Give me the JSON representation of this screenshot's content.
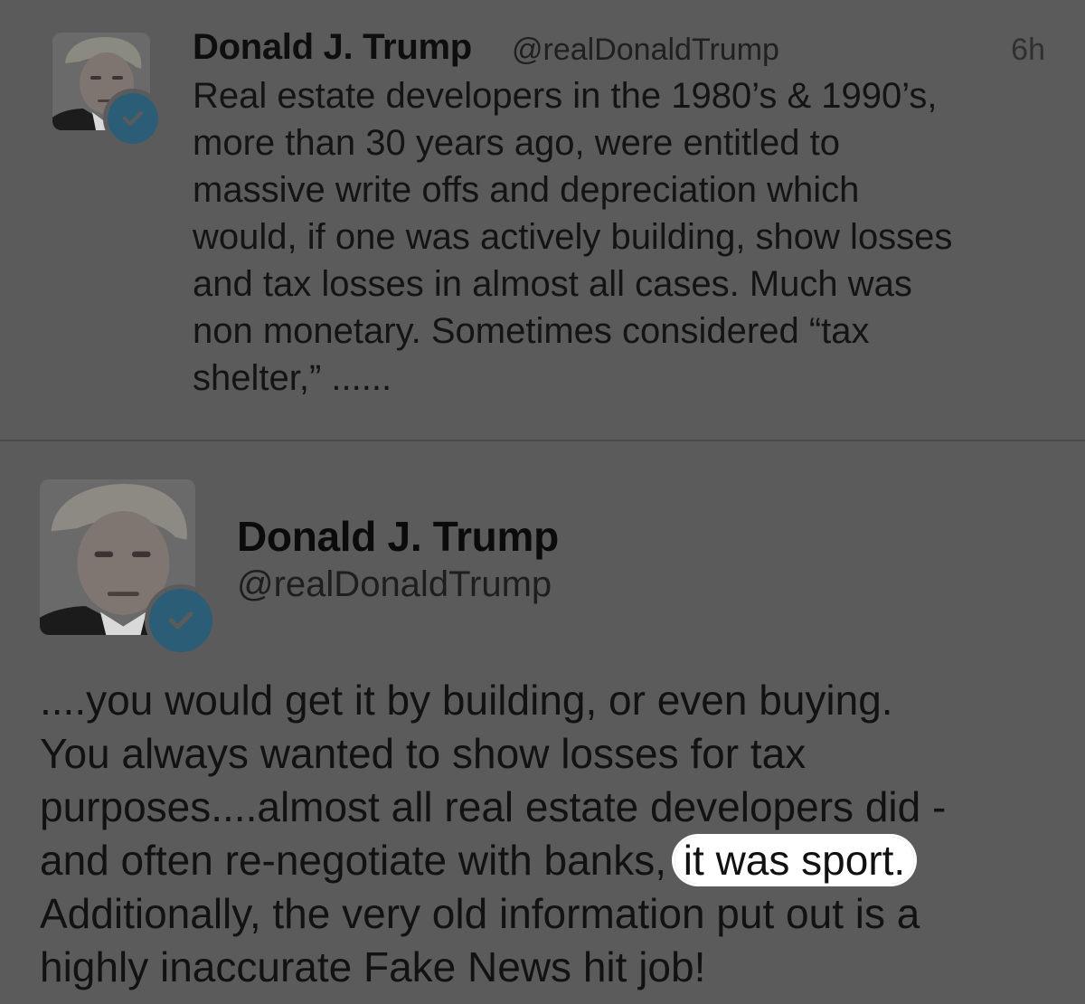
{
  "tweet1": {
    "author_name": "Donald J. Trump",
    "handle": "@realDonaldTrump",
    "timestamp": "6h",
    "avatar_icon": "profile-photo",
    "verified_icon": "verified-badge-icon",
    "lines": [
      "Real estate developers in the 1980’s & 1990’s,",
      "more than 30 years ago, were entitled to",
      "massive write offs and depreciation which",
      "would, if one was actively building, show losses",
      "and tax losses in almost all cases. Much was",
      "non monetary. Sometimes considered “tax",
      "shelter,” ......"
    ]
  },
  "tweet2": {
    "author_name": "Donald J. Trump",
    "handle": "@realDonaldTrump",
    "avatar_icon": "profile-photo",
    "verified_icon": "verified-badge-icon",
    "lines": [
      "....you would get it by building, or even buying.",
      "You always wanted to show losses for tax",
      "purposes....almost all real estate developers did -"
    ],
    "line4_before_highlight": "and often re-negotiate with banks, ",
    "highlighted_text": "it was sport.",
    "lines_after": [
      "Additionally, the very old information put out is a",
      "highly inaccurate Fake News hit job!"
    ]
  },
  "colors": {
    "background": "#5b5b5b",
    "verified_badge": "#2b5d77",
    "highlight": "#ffffff",
    "text": "#111111"
  }
}
